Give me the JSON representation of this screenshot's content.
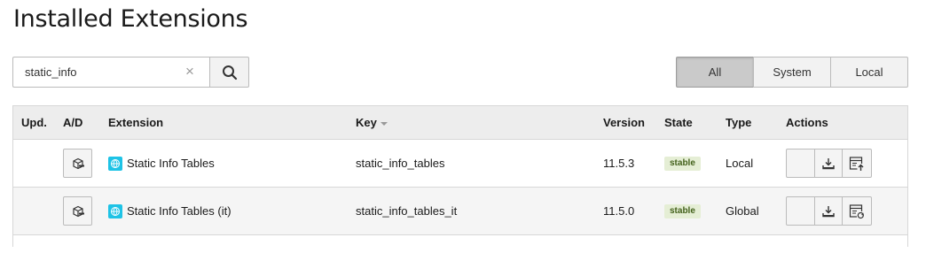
{
  "page": {
    "title": "Installed Extensions"
  },
  "search": {
    "value": "static_info",
    "placeholder": ""
  },
  "filter": {
    "options": [
      "All",
      "System",
      "Local"
    ],
    "selected": "All"
  },
  "table": {
    "headers": {
      "upd": "Upd.",
      "ad": "A/D",
      "extension": "Extension",
      "key": "Key",
      "version": "Version",
      "state": "State",
      "type": "Type",
      "actions": "Actions"
    },
    "sorted_by": "key",
    "rows": [
      {
        "extension": "Static Info Tables",
        "key": "static_info_tables",
        "version": "11.5.3",
        "state": "stable",
        "type": "Local",
        "action_icons": [
          "download-icon",
          "extension-update-icon"
        ]
      },
      {
        "extension": "Static Info Tables (it)",
        "key": "static_info_tables_it",
        "version": "11.5.0",
        "state": "stable",
        "type": "Global",
        "action_icons": [
          "download-icon",
          "extension-reload-icon"
        ]
      }
    ]
  },
  "colors": {
    "accent_active_filter": "#cacaca",
    "extension_icon": "#1ec3e6",
    "stable_badge_bg": "#e5eed5",
    "stable_badge_text": "#43611b"
  }
}
